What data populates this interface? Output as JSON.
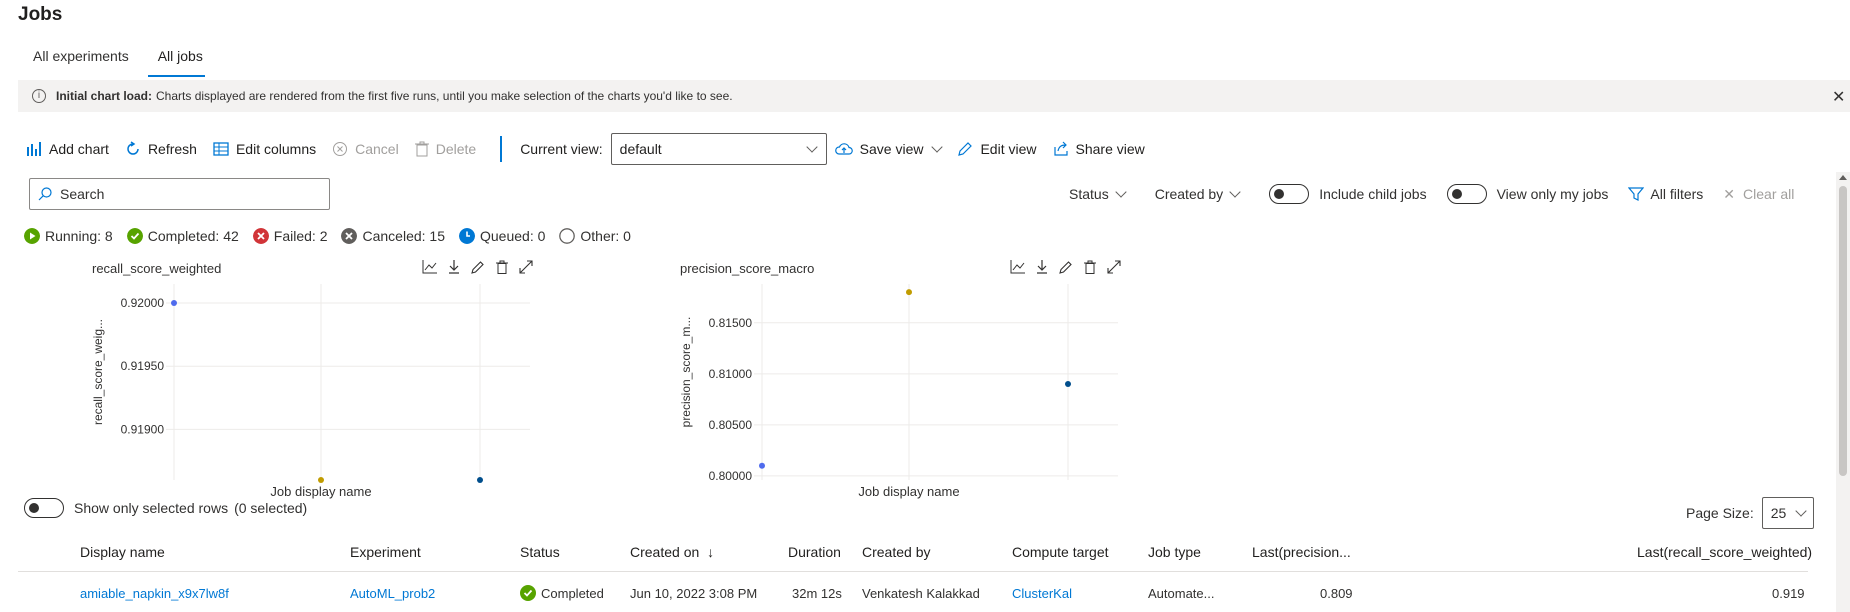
{
  "page": {
    "title": "Jobs"
  },
  "tabs": [
    {
      "label": "All experiments",
      "active": false
    },
    {
      "label": "All jobs",
      "active": true
    }
  ],
  "banner": {
    "bold": "Initial chart load:",
    "text": "Charts displayed are rendered from the first five runs, until you make selection of the charts you'd like to see."
  },
  "toolbar": {
    "add_chart": "Add chart",
    "refresh": "Refresh",
    "edit_columns": "Edit columns",
    "cancel": "Cancel",
    "delete": "Delete",
    "current_view_label": "Current view:",
    "current_view_value": "default",
    "save_view": "Save view",
    "edit_view": "Edit view",
    "share_view": "Share view"
  },
  "search": {
    "placeholder": "Search"
  },
  "filters": {
    "status": "Status",
    "created_by": "Created by",
    "include_child_jobs": "Include child jobs",
    "view_only_my_jobs": "View only my jobs",
    "all_filters": "All filters",
    "clear_all": "Clear all"
  },
  "status_counts": [
    {
      "label": "Running: 8",
      "color": "#57a300",
      "icon": "play-icon"
    },
    {
      "label": "Completed: 42",
      "color": "#57a300",
      "icon": "check-icon"
    },
    {
      "label": "Failed: 2",
      "color": "#d13438",
      "icon": "x-icon"
    },
    {
      "label": "Canceled: 15",
      "color": "#605e5c",
      "icon": "x-icon"
    },
    {
      "label": "Queued: 0",
      "color": "#0078d4",
      "icon": "clock-icon"
    },
    {
      "label": "Other: 0",
      "color": "#ffffff",
      "icon": "circle-icon"
    }
  ],
  "chart_data": [
    {
      "type": "scatter",
      "title": "recall_score_weighted",
      "ylabel": "recall_score_weig...",
      "xlabel": "Job display name",
      "ylim": [
        0.9186,
        0.92015
      ],
      "y_ticks": [
        "0.92000",
        "0.91950",
        "0.91900"
      ],
      "y_tick_values": [
        0.92,
        0.9195,
        0.919
      ],
      "points": [
        {
          "x": 0,
          "y": 0.92,
          "color": "#4f6bed"
        },
        {
          "x": 1,
          "y": 0.9186,
          "color": "#c19c00"
        },
        {
          "x": 2,
          "y": 0.9186,
          "color": "#004e8c"
        }
      ]
    },
    {
      "type": "scatter",
      "title": "precision_score_macro",
      "ylabel": "precision_score_m...",
      "xlabel": "Job display name",
      "ylim": [
        0.7996,
        0.8188
      ],
      "y_ticks": [
        "0.81500",
        "0.81000",
        "0.80500",
        "0.80000"
      ],
      "y_tick_values": [
        0.815,
        0.81,
        0.805,
        0.8
      ],
      "points": [
        {
          "x": 0,
          "y": 0.801,
          "color": "#4f6bed"
        },
        {
          "x": 1,
          "y": 0.818,
          "color": "#c19c00"
        },
        {
          "x": 2,
          "y": 0.809,
          "color": "#004e8c"
        }
      ]
    }
  ],
  "show_selected": {
    "label": "Show only selected rows",
    "count": "(0 selected)"
  },
  "page_size": {
    "label": "Page Size:",
    "value": "25"
  },
  "table": {
    "headers": {
      "display_name": "Display name",
      "experiment": "Experiment",
      "status": "Status",
      "created_on": "Created on",
      "sort_arrow": "↓",
      "duration": "Duration",
      "created_by": "Created by",
      "compute_target": "Compute target",
      "job_type": "Job type",
      "last_precision": "Last(precision...",
      "last_recall": "Last(recall_score_weighted)"
    },
    "rows": [
      {
        "display_name": "amiable_napkin_x9x7lw8f",
        "experiment": "AutoML_prob2",
        "status": "Completed",
        "created_on": "Jun 10, 2022 3:08 PM",
        "duration": "32m 12s",
        "created_by": "Venkatesh Kalakkad",
        "compute_target": "ClusterKal",
        "job_type": "Automate...",
        "last_precision": "0.809",
        "last_recall": "0.919"
      }
    ]
  }
}
